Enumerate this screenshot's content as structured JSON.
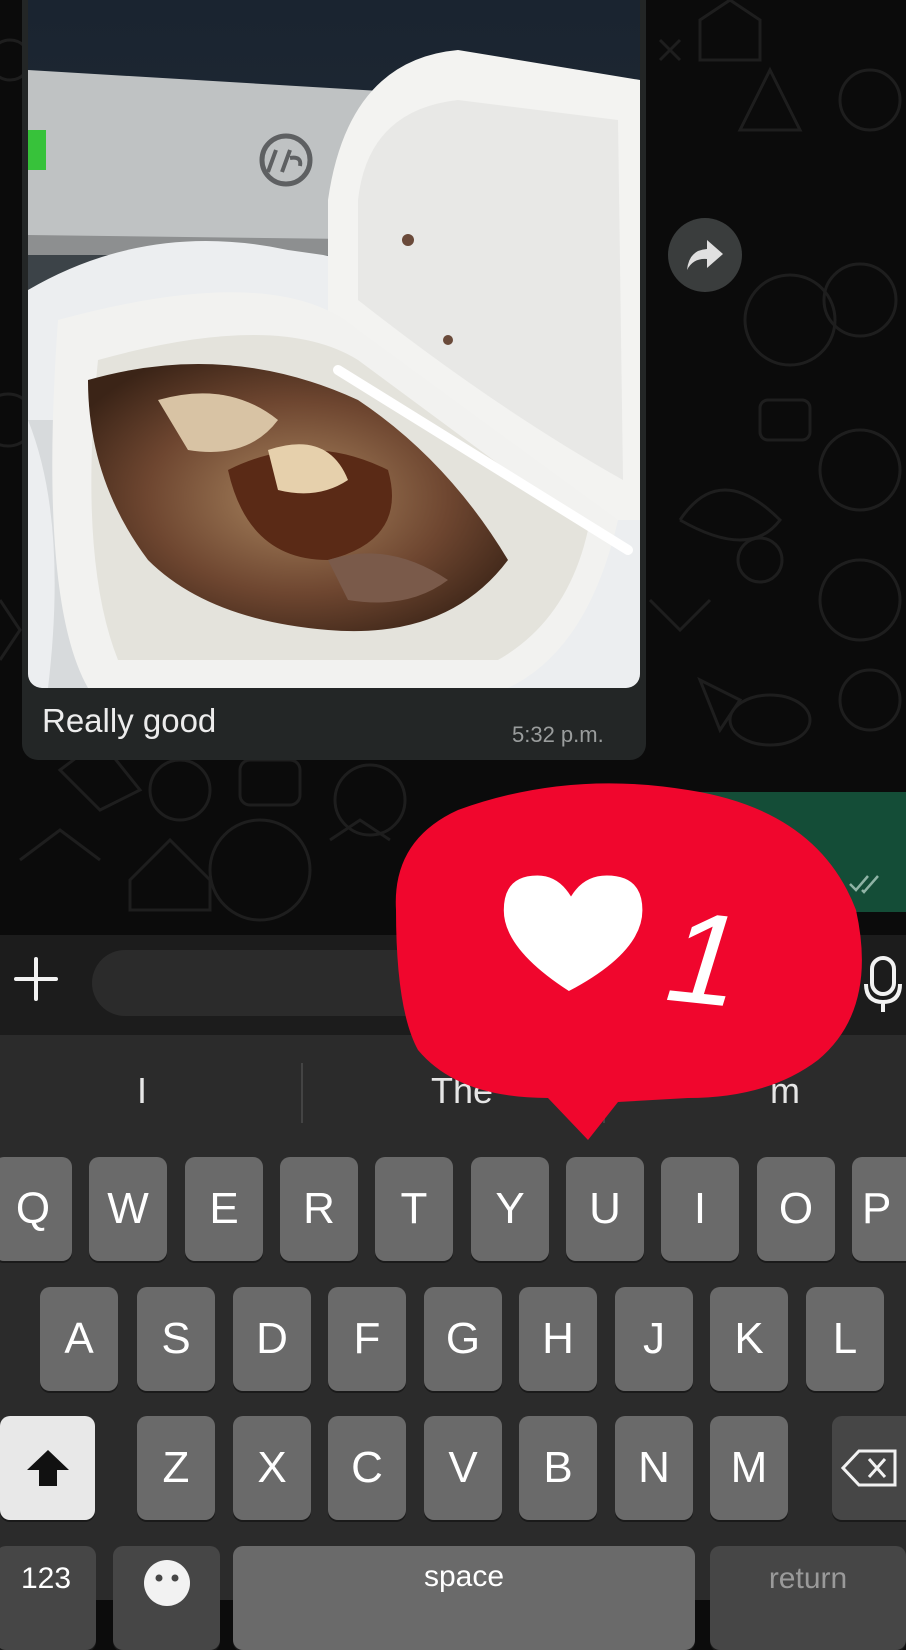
{
  "message": {
    "caption": "Really good",
    "time": "5:32 p.m."
  },
  "badge": {
    "count": "1",
    "color": "#f0062d"
  },
  "suggestions": [
    "I",
    "The",
    "m"
  ],
  "keyboard": {
    "row1": [
      "Q",
      "W",
      "E",
      "R",
      "T",
      "Y",
      "U",
      "I",
      "O",
      "P"
    ],
    "row2": [
      "A",
      "S",
      "D",
      "F",
      "G",
      "H",
      "J",
      "K",
      "L"
    ],
    "row3": [
      "Z",
      "X",
      "C",
      "V",
      "B",
      "N",
      "M"
    ],
    "numbers_label": "123",
    "space_label": "space",
    "return_label": "return"
  },
  "colors": {
    "incoming_bubble": "#232626",
    "outgoing_bubble": "#144d37",
    "keyboard_bg": "#2b2b2b",
    "key": "#6a6a6a"
  }
}
